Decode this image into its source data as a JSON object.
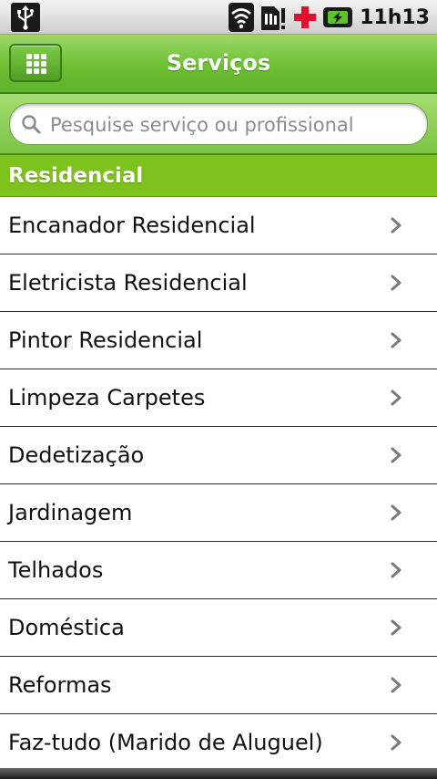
{
  "status_bar": {
    "time": "11h13",
    "icons": [
      "usb-icon",
      "wifi-icon",
      "sim-alert-icon",
      "red-cross-icon",
      "battery-charging-icon"
    ]
  },
  "header": {
    "title": "Serviços",
    "menu_icon": "grid-icon"
  },
  "search": {
    "placeholder": "Pesquise serviço ou profissional",
    "value": ""
  },
  "section": {
    "title": "Residencial"
  },
  "services": [
    {
      "label": "Encanador Residencial"
    },
    {
      "label": "Eletricista Residencial"
    },
    {
      "label": "Pintor Residencial"
    },
    {
      "label": "Limpeza Carpetes"
    },
    {
      "label": "Dedetização"
    },
    {
      "label": "Jardinagem"
    },
    {
      "label": "Telhados"
    },
    {
      "label": "Doméstica"
    },
    {
      "label": "Reformas"
    },
    {
      "label": "Faz-tudo (Marido de Aluguel)"
    }
  ],
  "colors": {
    "accent_green": "#6cbf32",
    "section_green": "#7ec21d"
  }
}
